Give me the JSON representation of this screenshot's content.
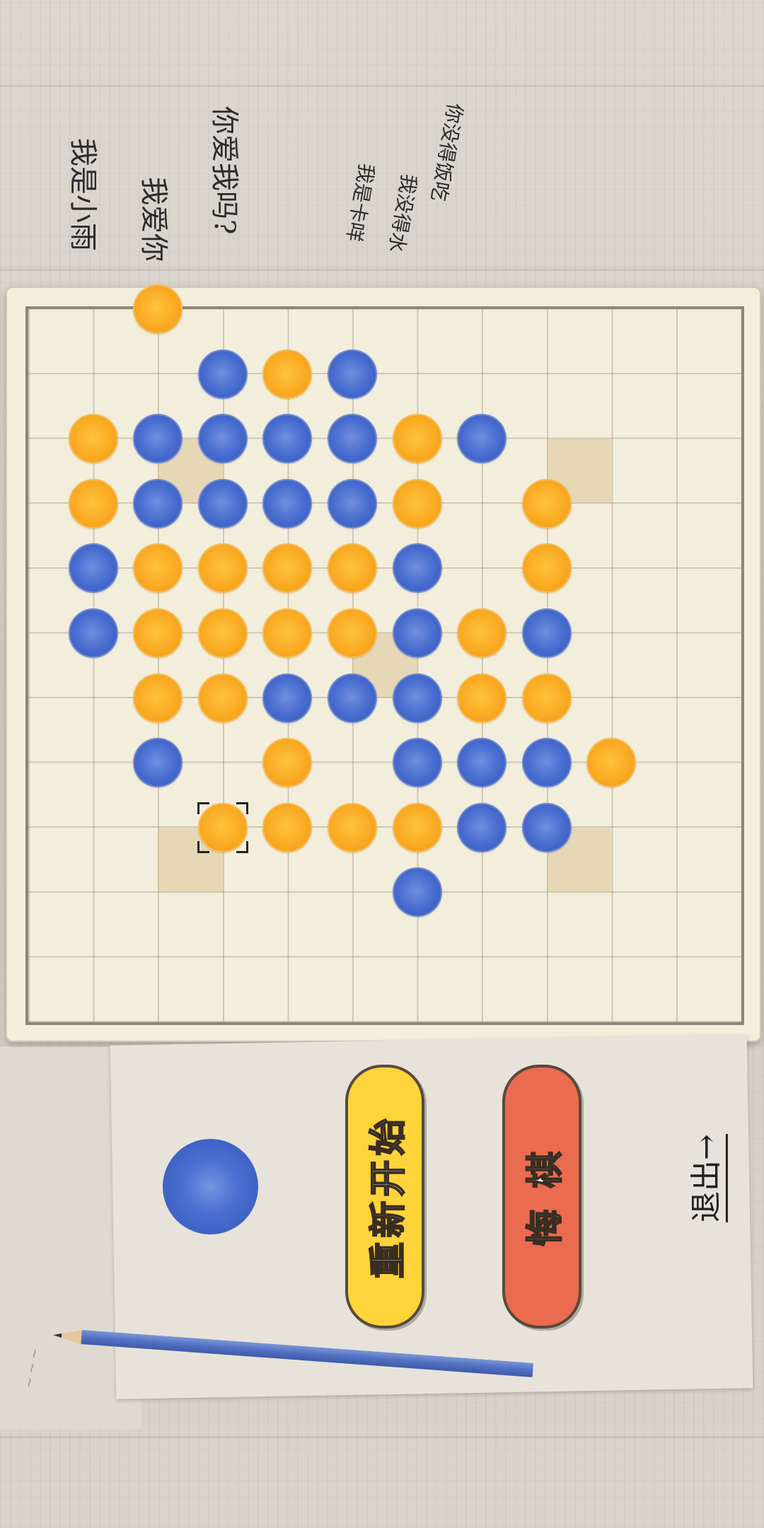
{
  "notes": {
    "line1": "我是小雨",
    "line2": "我爱你",
    "line3": "你爱我吗?",
    "line4": "我是卡咩",
    "line5": "我没得水",
    "line6": "你没得饭吃"
  },
  "board": {
    "size": 11,
    "stones": [
      {
        "color": "orange",
        "row": 0,
        "col": 2
      },
      {
        "color": "blue",
        "row": 1,
        "col": 3
      },
      {
        "color": "orange",
        "row": 1,
        "col": 4
      },
      {
        "color": "blue",
        "row": 1,
        "col": 5
      },
      {
        "color": "orange",
        "row": 2,
        "col": 1
      },
      {
        "color": "blue",
        "row": 2,
        "col": 2
      },
      {
        "color": "blue",
        "row": 2,
        "col": 3
      },
      {
        "color": "blue",
        "row": 2,
        "col": 4
      },
      {
        "color": "blue",
        "row": 2,
        "col": 5
      },
      {
        "color": "orange",
        "row": 2,
        "col": 6
      },
      {
        "color": "blue",
        "row": 2,
        "col": 7
      },
      {
        "color": "orange",
        "row": 3,
        "col": 1
      },
      {
        "color": "blue",
        "row": 3,
        "col": 2
      },
      {
        "color": "blue",
        "row": 3,
        "col": 3
      },
      {
        "color": "blue",
        "row": 3,
        "col": 4
      },
      {
        "color": "blue",
        "row": 3,
        "col": 5
      },
      {
        "color": "orange",
        "row": 3,
        "col": 6
      },
      {
        "color": "orange",
        "row": 3,
        "col": 8
      },
      {
        "color": "blue",
        "row": 4,
        "col": 1
      },
      {
        "color": "orange",
        "row": 4,
        "col": 2
      },
      {
        "color": "orange",
        "row": 4,
        "col": 3
      },
      {
        "color": "orange",
        "row": 4,
        "col": 4
      },
      {
        "color": "orange",
        "row": 4,
        "col": 5
      },
      {
        "color": "blue",
        "row": 4,
        "col": 6
      },
      {
        "color": "orange",
        "row": 4,
        "col": 8
      },
      {
        "color": "blue",
        "row": 5,
        "col": 1
      },
      {
        "color": "orange",
        "row": 5,
        "col": 2
      },
      {
        "color": "orange",
        "row": 5,
        "col": 3
      },
      {
        "color": "orange",
        "row": 5,
        "col": 4
      },
      {
        "color": "orange",
        "row": 5,
        "col": 5
      },
      {
        "color": "blue",
        "row": 5,
        "col": 6
      },
      {
        "color": "orange",
        "row": 5,
        "col": 7
      },
      {
        "color": "blue",
        "row": 5,
        "col": 8
      },
      {
        "color": "orange",
        "row": 6,
        "col": 2
      },
      {
        "color": "orange",
        "row": 6,
        "col": 3
      },
      {
        "color": "blue",
        "row": 6,
        "col": 4
      },
      {
        "color": "blue",
        "row": 6,
        "col": 5
      },
      {
        "color": "blue",
        "row": 6,
        "col": 6
      },
      {
        "color": "orange",
        "row": 6,
        "col": 7
      },
      {
        "color": "orange",
        "row": 6,
        "col": 8
      },
      {
        "color": "blue",
        "row": 7,
        "col": 2
      },
      {
        "color": "orange",
        "row": 7,
        "col": 4
      },
      {
        "color": "blue",
        "row": 7,
        "col": 6
      },
      {
        "color": "blue",
        "row": 7,
        "col": 7
      },
      {
        "color": "blue",
        "row": 7,
        "col": 8
      },
      {
        "color": "orange",
        "row": 7,
        "col": 9
      },
      {
        "color": "orange",
        "row": 8,
        "col": 3
      },
      {
        "color": "orange",
        "row": 8,
        "col": 4
      },
      {
        "color": "orange",
        "row": 8,
        "col": 5
      },
      {
        "color": "orange",
        "row": 8,
        "col": 6
      },
      {
        "color": "blue",
        "row": 8,
        "col": 7
      },
      {
        "color": "blue",
        "row": 8,
        "col": 8
      },
      {
        "color": "blue",
        "row": 9,
        "col": 6
      }
    ],
    "last_move": {
      "row": 8,
      "col": 3
    },
    "highlight_cells": [
      {
        "row": 2,
        "col": 2
      },
      {
        "row": 2,
        "col": 8
      },
      {
        "row": 5,
        "col": 5
      },
      {
        "row": 8,
        "col": 2
      },
      {
        "row": 8,
        "col": 8
      }
    ]
  },
  "current_turn": {
    "color": "blue",
    "icon": "blue-stone-icon"
  },
  "buttons": {
    "restart_label": "重新开始",
    "undo_label": "悔 棋",
    "exit_label": "退出→"
  },
  "colors": {
    "blue": "#4a6fd0",
    "orange": "#f9aa22",
    "restart_bg": "#ffd43a",
    "undo_bg": "#ea6b50",
    "board_bg": "#f2eedb"
  }
}
